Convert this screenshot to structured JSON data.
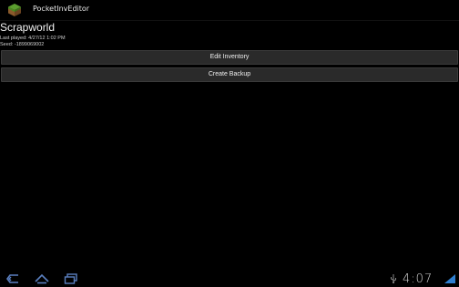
{
  "app": {
    "title": "PocketInvEditor",
    "icon": "grass-block-icon"
  },
  "world": {
    "name": "Scrapworld",
    "last_played": "Last played: 4/27/12 1:02 PM",
    "seed": "Seed: -1899069002"
  },
  "actions": {
    "edit_inventory": "Edit Inventory",
    "create_backup": "Create Backup"
  },
  "system_bar": {
    "back_icon": "back-arrow-icon",
    "home_icon": "home-icon",
    "recent_apps_icon": "recent-apps-icon",
    "usb_icon": "usb-icon",
    "signal_icon": "signal-icon",
    "time": "4:07"
  },
  "colors": {
    "background": "#000000",
    "button": "#2a2a2a",
    "nav_icon": "#5a7fbf",
    "block_green": "#5b9e2f",
    "block_dirt": "#8a5a2b"
  }
}
